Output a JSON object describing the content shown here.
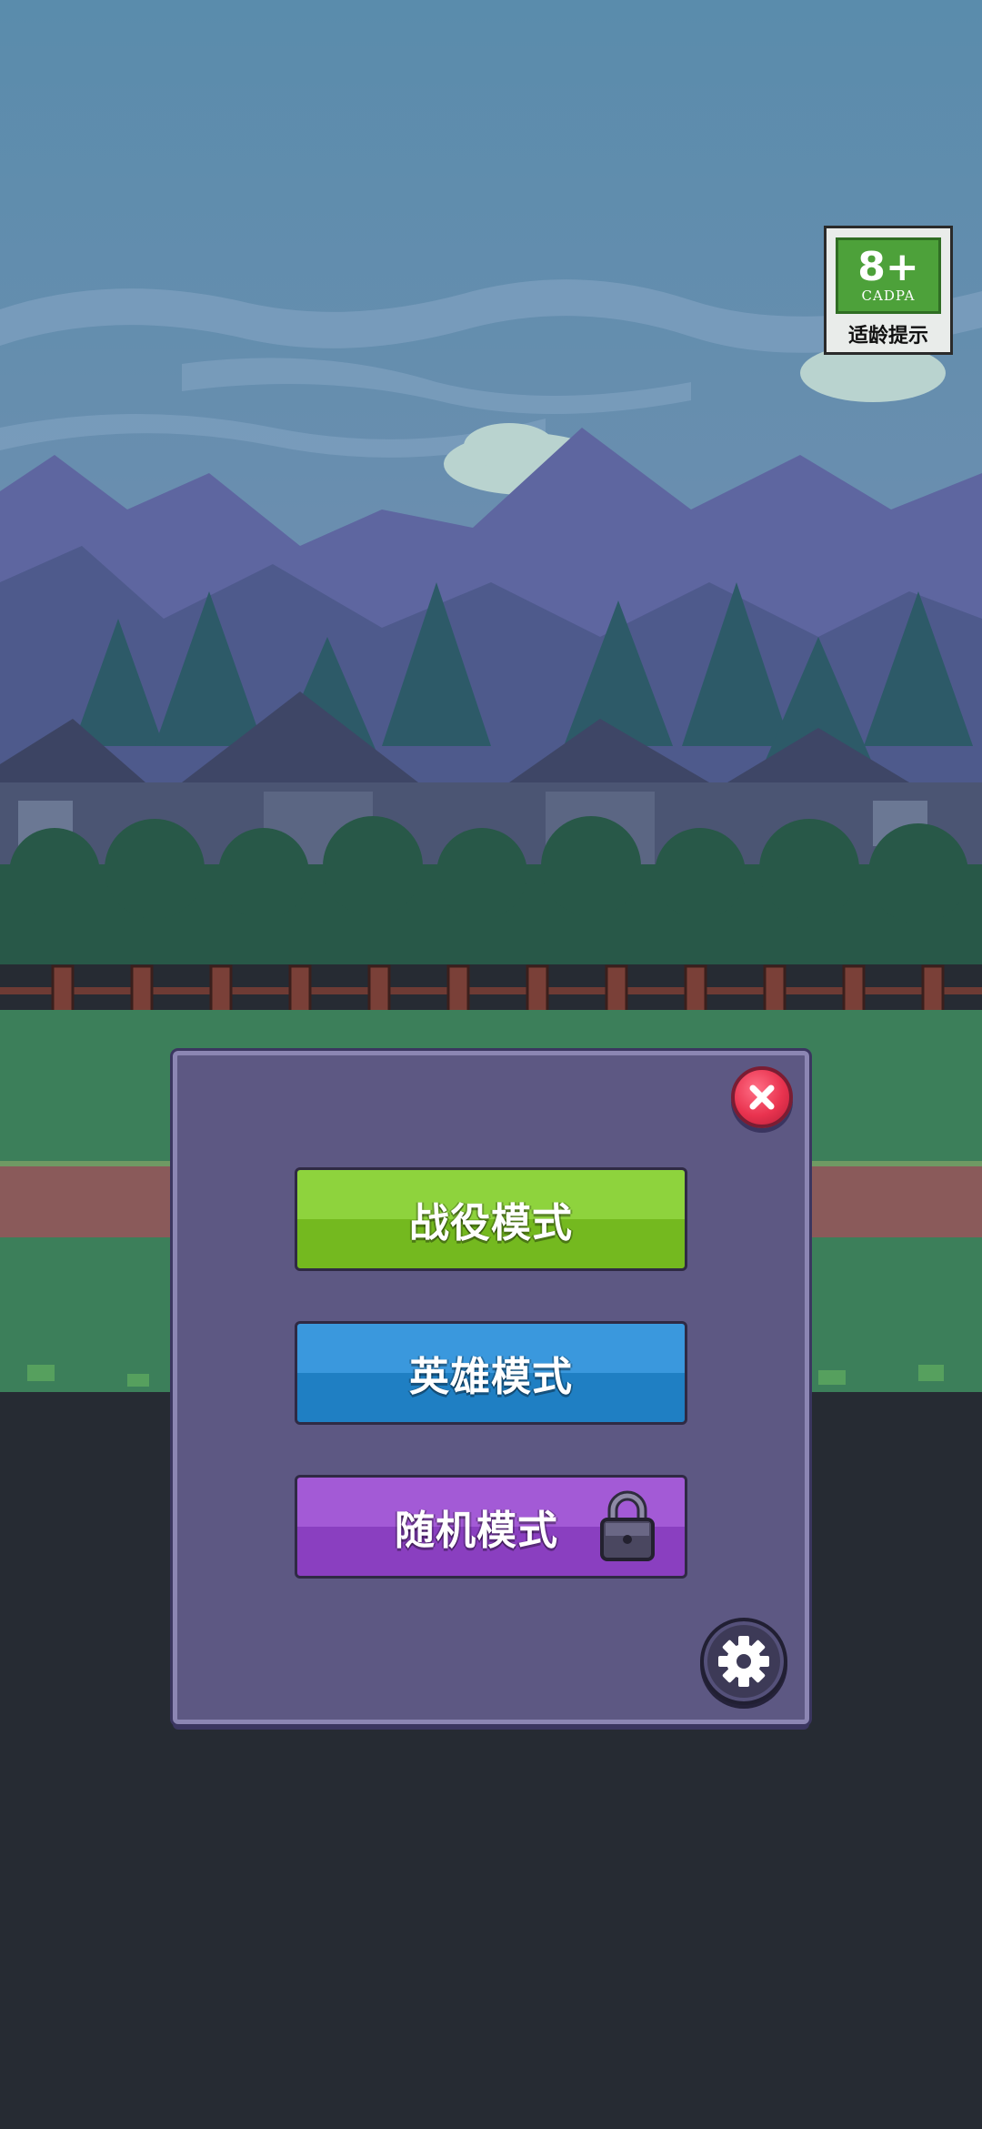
{
  "age_rating": {
    "age": "8+",
    "org": "CADPA",
    "hint": "适龄提示"
  },
  "menu": {
    "buttons": [
      {
        "label": "战役模式",
        "color": "#8ed33d",
        "locked": false
      },
      {
        "label": "英雄模式",
        "color": "#3a98dd",
        "locked": false
      },
      {
        "label": "随机模式",
        "color": "#a35ad6",
        "locked": true
      }
    ]
  },
  "icons": {
    "close": "close-icon",
    "settings": "gear-icon",
    "lock": "lock-icon"
  },
  "colors": {
    "panel": "#5d5883",
    "sky": "#5787a8",
    "ground_dark": "#262b33"
  }
}
